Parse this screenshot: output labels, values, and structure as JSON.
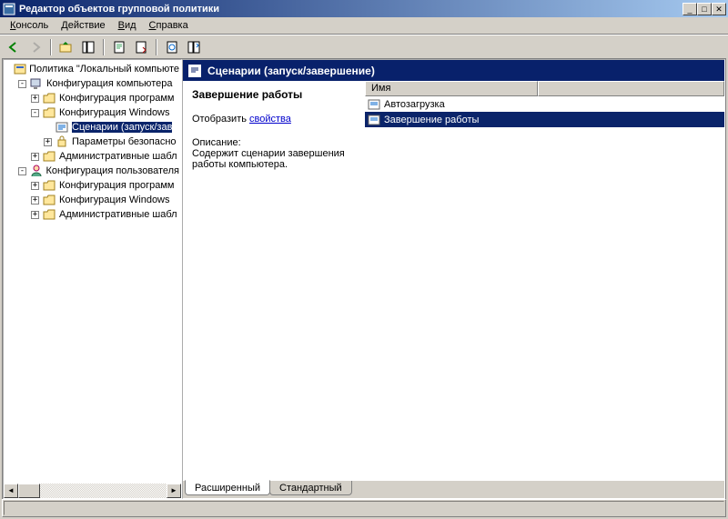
{
  "window": {
    "title": "Редактор объектов групповой политики"
  },
  "menu": {
    "console": "Консоль",
    "action": "Действие",
    "view": "Вид",
    "help": "Справка",
    "console_u": "К",
    "action_u": "Д",
    "view_u": "В",
    "help_u": "С"
  },
  "tree": {
    "root": "Политика \"Локальный компьюте",
    "computer_conf": "Конфигурация компьютера",
    "software_settings": "Конфигурация программ",
    "windows_settings": "Конфигурация Windows",
    "scripts": "Сценарии (запуск/зав",
    "security": "Параметры безопасно",
    "admin_templates": "Административные шабл",
    "user_conf": "Конфигурация пользователя",
    "u_software_settings": "Конфигурация программ",
    "u_windows_settings": "Конфигурация Windows",
    "u_admin_templates": "Административные шабл"
  },
  "header": {
    "title": "Сценарии (запуск/завершение)"
  },
  "details": {
    "title": "Завершение работы",
    "show_label": "Отобразить ",
    "props_link": "свойства",
    "desc_label": "Описание:",
    "desc_text": "Содержит сценарии завершения работы компьютера."
  },
  "list": {
    "col_name": "Имя",
    "items": [
      {
        "label": "Автозагрузка",
        "selected": false
      },
      {
        "label": "Завершение работы",
        "selected": true
      }
    ]
  },
  "tabs": {
    "extended": "Расширенный",
    "standard": "Стандартный"
  }
}
